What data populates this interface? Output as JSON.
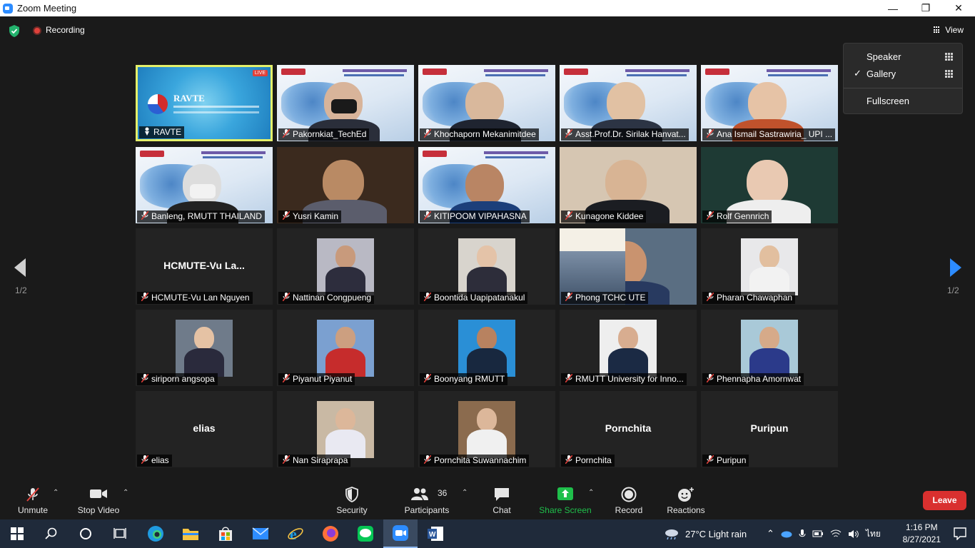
{
  "window": {
    "title": "Zoom Meeting"
  },
  "topbar": {
    "recording_label": "Recording",
    "view_label": "View"
  },
  "view_menu": {
    "items": [
      "Speaker",
      "Gallery",
      "Fullscreen"
    ],
    "selected": "Gallery"
  },
  "pagination": {
    "left": "1/2",
    "right": "1/2"
  },
  "tiles": [
    {
      "name": "RAVTE",
      "live": "LIVE",
      "slide_title": "RAVTE"
    },
    {
      "name": "Pakornkiat_TechEd"
    },
    {
      "name": "Khochaporn Mekanimitdee"
    },
    {
      "name": "Asst.Prof.Dr. Sirilak Hanvat..."
    },
    {
      "name": "Ana Ismail Sastrawiria_ UPI ..."
    },
    {
      "name": "Banleng, RMUTT THAILAND"
    },
    {
      "name": "Yusri Kamin"
    },
    {
      "name": "KITIPOOM VIPAHASNA"
    },
    {
      "name": "Kunagone Kiddee"
    },
    {
      "name": "Rolf Gennrich"
    },
    {
      "name": "HCMUTE-Vu Lan Nguyen",
      "big": "HCMUTE-Vu  La..."
    },
    {
      "name": "Nattinan Congpueng"
    },
    {
      "name": "Boontida Uapipatanakul"
    },
    {
      "name": "Phong TCHC UTE"
    },
    {
      "name": "Pharan Chawaphan"
    },
    {
      "name": "siriporn angsopa"
    },
    {
      "name": "Piyanut Piyanut"
    },
    {
      "name": "Boonyang RMUTT"
    },
    {
      "name": "RMUTT University for Inno..."
    },
    {
      "name": "Phennapha Amornwat"
    },
    {
      "name": "elias",
      "big": "elias"
    },
    {
      "name": "Nan Siraprapa"
    },
    {
      "name": "Pornchita Suwannachim"
    },
    {
      "name": "Pornchita",
      "big": "Pornchita"
    },
    {
      "name": "Puripun",
      "big": "Puripun"
    }
  ],
  "toolbar": {
    "unmute": "Unmute",
    "stop_video": "Stop Video",
    "security": "Security",
    "participants": "Participants",
    "participants_count": "36",
    "chat": "Chat",
    "share_screen": "Share Screen",
    "record": "Record",
    "reactions": "Reactions",
    "leave": "Leave"
  },
  "taskbar": {
    "weather": "27°C  Light rain",
    "lang": "ไทย",
    "time": "1:16 PM",
    "date": "8/27/2021"
  },
  "colors": {
    "accent": "#2d8cff",
    "share_green": "#1fbf4b",
    "leave_red": "#d9302f",
    "active_speaker": "#e4f06a"
  }
}
